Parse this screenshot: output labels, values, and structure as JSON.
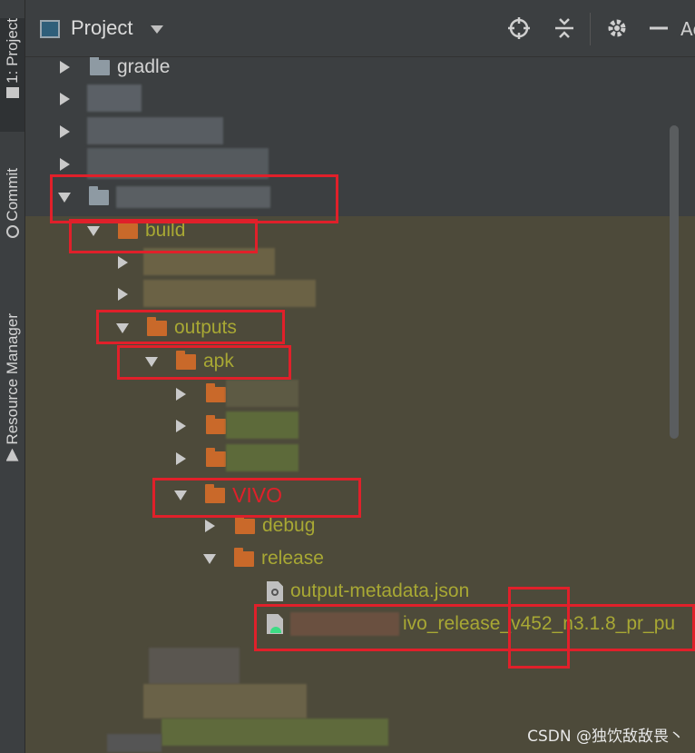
{
  "sidebar": {
    "tabs": [
      {
        "label": "1: Project",
        "active": true
      },
      {
        "label": "Commit",
        "active": false
      },
      {
        "label": "Resource Manager",
        "active": false
      }
    ]
  },
  "header": {
    "title": "Project",
    "buttons": [
      "locate-icon",
      "collapse-icon",
      "gear-icon",
      "minimize-icon"
    ],
    "cut_label": "Ad"
  },
  "tree": {
    "items": [
      {
        "label": "gradle",
        "state": "collapsed",
        "icon": "folder-gray"
      },
      {
        "label": "",
        "state": "collapsed",
        "icon": "blurred"
      },
      {
        "label": "",
        "state": "collapsed",
        "icon": "blurred"
      },
      {
        "label": "",
        "state": "collapsed",
        "icon": "blurred"
      },
      {
        "label": "",
        "state": "expanded",
        "icon": "module-folder"
      },
      {
        "label": "build",
        "state": "expanded",
        "icon": "folder-orange"
      },
      {
        "label": "",
        "state": "collapsed",
        "icon": "blurred"
      },
      {
        "label": "",
        "state": "collapsed",
        "icon": "blurred"
      },
      {
        "label": "outputs",
        "state": "expanded",
        "icon": "folder-orange"
      },
      {
        "label": "apk",
        "state": "expanded",
        "icon": "folder-orange"
      },
      {
        "label": "",
        "state": "collapsed",
        "icon": "folder-orange"
      },
      {
        "label": "",
        "state": "collapsed",
        "icon": "folder-orange"
      },
      {
        "label": "",
        "state": "collapsed",
        "icon": "folder-orange"
      },
      {
        "label": "VIVO",
        "state": "expanded",
        "icon": "folder-orange"
      },
      {
        "label": "debug",
        "state": "collapsed",
        "icon": "folder-orange"
      },
      {
        "label": "release",
        "state": "expanded",
        "icon": "folder-orange"
      },
      {
        "label": "output-metadata.json",
        "icon": "json-file"
      },
      {
        "label": "ivo_release_v452_n3.1.8_pr_pu",
        "icon": "apk-file"
      }
    ]
  },
  "watermark": "CSDN @独饮敌敌畏丶",
  "colors": {
    "background": "#3c3f41",
    "excluded_background": "#4d4a3a",
    "excluded_text": "#a8a834",
    "annotation_red": "#e0202a",
    "folder_orange": "#c9692a"
  }
}
